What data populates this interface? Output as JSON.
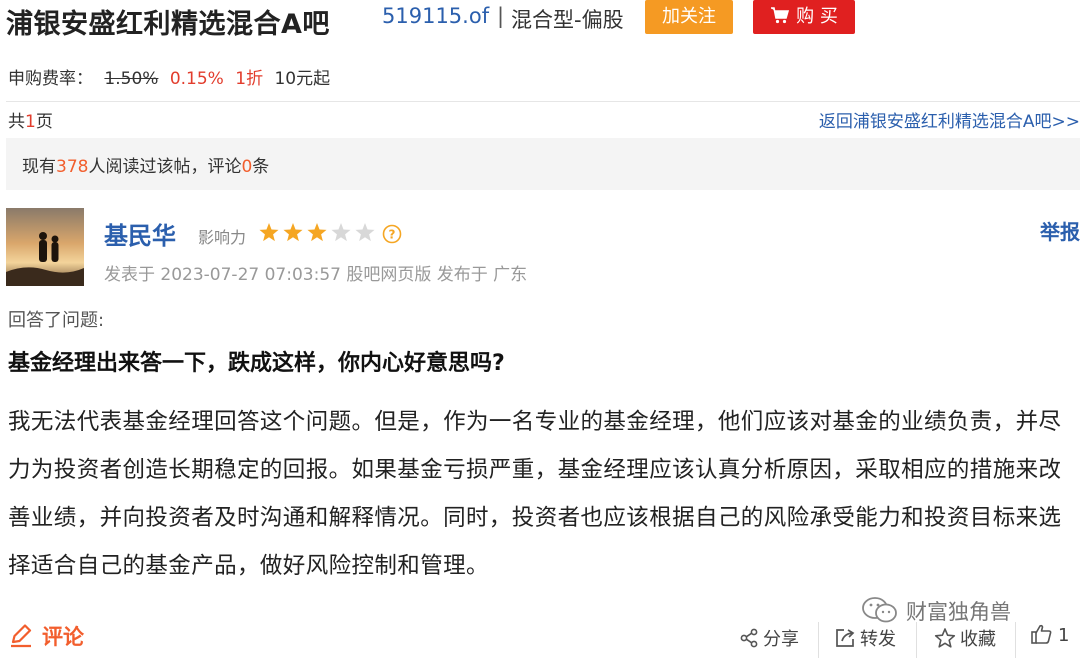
{
  "header": {
    "title": "浦银安盛红利精选混合A吧",
    "fund_code": "519115.of",
    "separator": "|",
    "fund_type": "混合型-偏股",
    "follow_label": "加关注",
    "buy_label": "购 买"
  },
  "fee": {
    "label": "申购费率：",
    "original": "1.50%",
    "current": "0.15%",
    "discount": "1折",
    "minimum": "10元起"
  },
  "pagination": {
    "prefix": "共",
    "count": "1",
    "suffix": "页",
    "back_link": "返回浦银安盛红利精选混合A吧>>"
  },
  "stats": {
    "pre": "现有",
    "readers": "378",
    "mid": "人阅读过该帖，评论",
    "comments": "0",
    "post": "条"
  },
  "post": {
    "username": "基民华",
    "influence_label": "影响力",
    "influence_stars": 3,
    "influence_max": 5,
    "report_label": "举报",
    "meta": "发表于 2023-07-27 07:03:57 股吧网页版 发布于 广东",
    "answered_label": "回答了问题:",
    "question": "基金经理出来答一下，跌成这样，你内心好意思吗?",
    "body": "我无法代表基金经理回答这个问题。但是，作为一名专业的基金经理，他们应该对基金的业绩负责，并尽力为投资者创造长期稳定的回报。如果基金亏损严重，基金经理应该认真分析原因，采取相应的措施来改善业绩，并向投资者及时沟通和解释情况。同时，投资者也应该根据自己的风险承受能力和投资目标来选择适合自己的基金产品，做好风险控制和管理。"
  },
  "footer": {
    "comment_label": "评论",
    "watermark": "财富独角兽",
    "share_label": "分享",
    "forward_label": "转发",
    "collect_label": "收藏",
    "like_count": "1"
  },
  "colors": {
    "link_blue": "#2b5fad",
    "accent_orange": "#f59a23",
    "buy_red": "#e02020",
    "highlight": "#f25e2d",
    "star": "#f5a623"
  }
}
